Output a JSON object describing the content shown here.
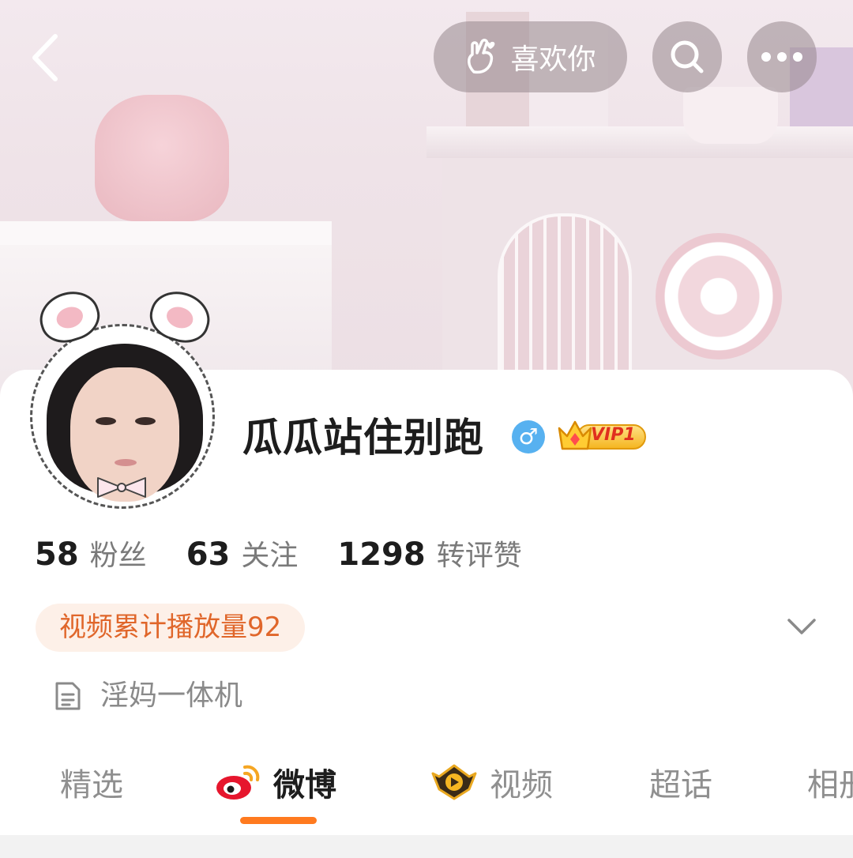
{
  "cover": {
    "description_icon": "cover-photo"
  },
  "header": {
    "back_icon": "chevron-left-icon",
    "like_button": {
      "icon": "finger-heart-icon",
      "label": "喜欢你"
    },
    "search_icon": "search-icon",
    "more_icon": "more-dots-icon"
  },
  "profile": {
    "username": "瓜瓜站住别跑",
    "gender_symbol": "♂",
    "vip_label": "VIP1",
    "stats": [
      {
        "value": "58",
        "label": "粉丝"
      },
      {
        "value": "63",
        "label": "关注"
      },
      {
        "value": "1298",
        "label": "转评赞"
      }
    ],
    "badge": "视频累计播放量92",
    "bio": "淫妈一体机"
  },
  "tabs": [
    {
      "label": "精选",
      "active": false
    },
    {
      "label": "微博",
      "active": true
    },
    {
      "label": "视频",
      "active": false
    },
    {
      "label": "超话",
      "active": false
    },
    {
      "label": "相册",
      "active": false
    }
  ],
  "colors": {
    "accent": "#ff7a1f",
    "badge_text": "#e0662a",
    "badge_bg": "#fdf0e8",
    "gender_bg": "#57b1f0"
  }
}
